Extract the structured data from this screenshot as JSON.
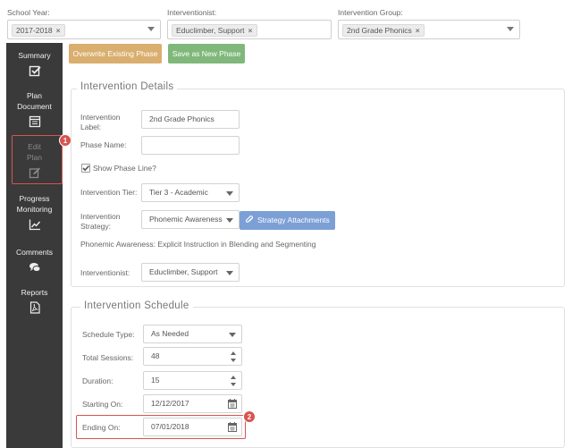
{
  "filters": {
    "school_year": {
      "label": "School Year:",
      "chip": "2017-2018"
    },
    "interventionist": {
      "label": "Interventionist:",
      "chip": "Educlimber, Support"
    },
    "intervention_group": {
      "label": "Intervention Group:",
      "chip": "2nd Grade Phonics"
    },
    "remove_glyph": "×"
  },
  "sidebar": {
    "items": [
      {
        "label_1": "Summary",
        "label_2": "",
        "icon": "checkbox-icon"
      },
      {
        "label_1": "Plan",
        "label_2": "Document",
        "icon": "document-icon"
      },
      {
        "label_1": "Edit",
        "label_2": "Plan",
        "icon": "edit-icon"
      },
      {
        "label_1": "Progress",
        "label_2": "Monitoring",
        "icon": "line-chart-icon"
      },
      {
        "label_1": "Comments",
        "label_2": "",
        "icon": "comments-icon"
      },
      {
        "label_1": "Reports",
        "label_2": "",
        "icon": "pdf-icon"
      }
    ]
  },
  "toolbar": {
    "overwrite_label": "Overwrite Existing Phase",
    "save_new_label": "Save as New Phase",
    "overwrite_color": "#d9ae6e",
    "save_new_color": "#7fb87a"
  },
  "details": {
    "title": "Intervention Details",
    "label_field_line1": "Intervention",
    "label_field_line2": "Label:",
    "label_value": "2nd Grade Phonics",
    "phase_name_label": "Phase Name:",
    "phase_name_value": "",
    "show_phase_line_label": "Show Phase Line?",
    "show_phase_line_checked": true,
    "tier_label": "Intervention Tier:",
    "tier_value": "Tier 3 - Academic",
    "strategy_label_line1": "Intervention",
    "strategy_label_line2": "Strategy:",
    "strategy_value": "Phonemic Awareness",
    "strategy_attachments_label": "Strategy Attachments",
    "strategy_description": "Phonemic Awareness: Explicit Instruction in Blending and Segmenting",
    "interventionist_label": "Interventionist:",
    "interventionist_value": "Educlimber, Support"
  },
  "schedule": {
    "title": "Intervention Schedule",
    "type_label": "Schedule Type:",
    "type_value": "As Needed",
    "sessions_label": "Total Sessions:",
    "sessions_value": "48",
    "duration_label": "Duration:",
    "duration_value": "15",
    "start_label": "Starting On:",
    "start_value": "12/12/2017",
    "end_label": "Ending On:",
    "end_value": "07/01/2018"
  },
  "callouts": {
    "step_1": "1",
    "step_2": "2",
    "color": "#d9534f"
  }
}
